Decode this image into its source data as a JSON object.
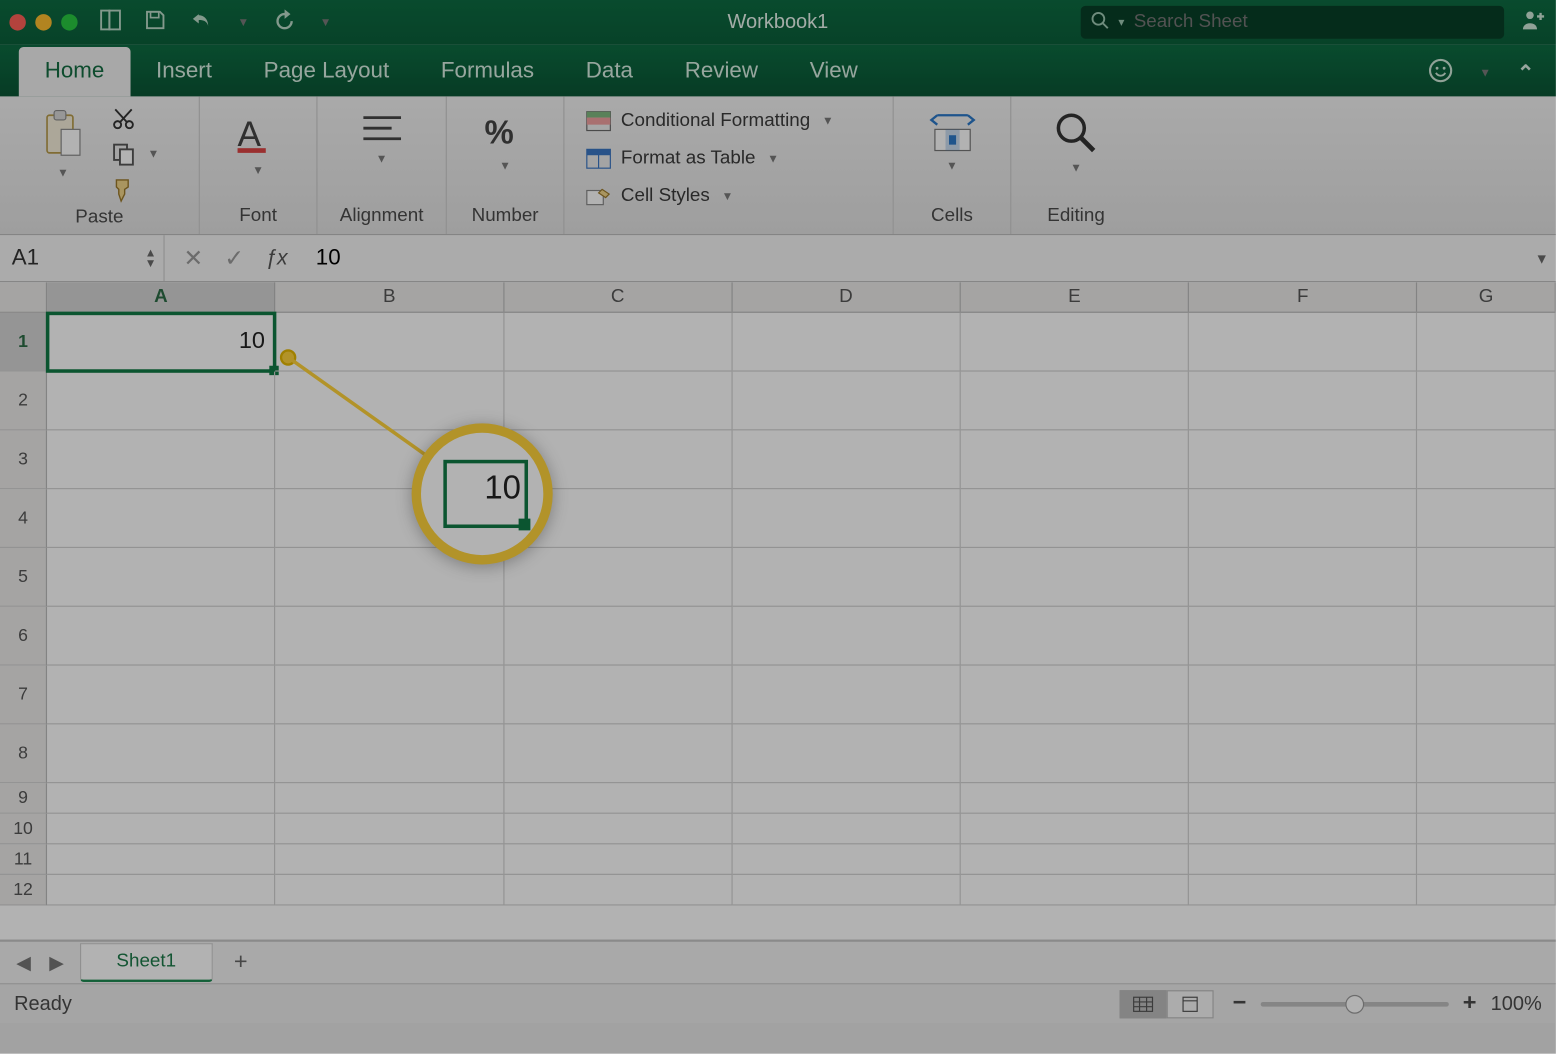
{
  "window": {
    "title": "Workbook1"
  },
  "search": {
    "placeholder": "Search Sheet"
  },
  "tabs": [
    "Home",
    "Insert",
    "Page Layout",
    "Formulas",
    "Data",
    "Review",
    "View"
  ],
  "activeTab": "Home",
  "ribbon": {
    "paste": "Paste",
    "font": "Font",
    "alignment": "Alignment",
    "number": "Number",
    "condfmt": "Conditional Formatting",
    "fmttable": "Format as Table",
    "cellstyles": "Cell Styles",
    "cells": "Cells",
    "editing": "Editing"
  },
  "namebox": "A1",
  "formula": "10",
  "columns": [
    "A",
    "B",
    "C",
    "D",
    "E",
    "F",
    "G"
  ],
  "rows_tall": [
    1,
    2,
    3,
    4,
    5,
    6,
    7,
    8
  ],
  "rows_small": [
    9,
    10,
    11,
    12
  ],
  "selectedCellValue": "10",
  "callout_value": "10",
  "sheet": {
    "name": "Sheet1",
    "add": "+"
  },
  "status": {
    "ready": "Ready",
    "zoom": "100%"
  }
}
